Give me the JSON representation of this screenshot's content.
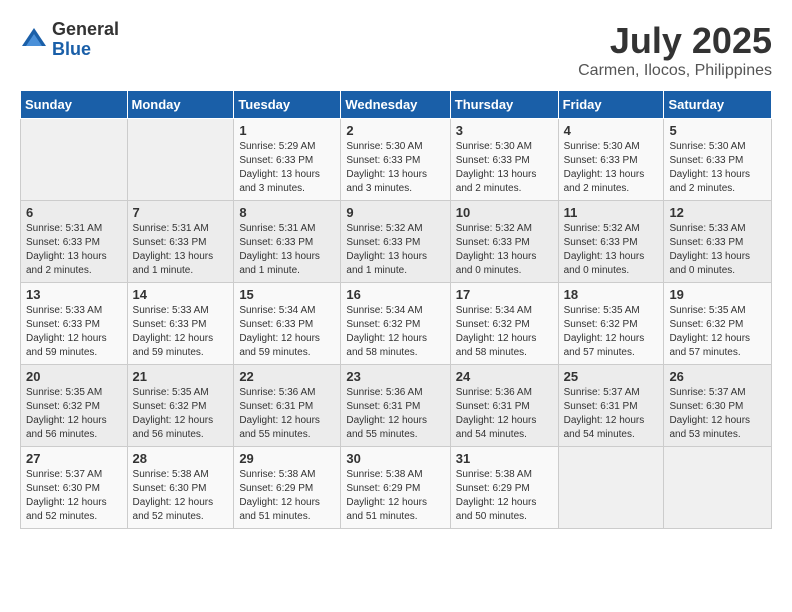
{
  "logo": {
    "general": "General",
    "blue": "Blue"
  },
  "title": {
    "month": "July 2025",
    "location": "Carmen, Ilocos, Philippines"
  },
  "weekdays": [
    "Sunday",
    "Monday",
    "Tuesday",
    "Wednesday",
    "Thursday",
    "Friday",
    "Saturday"
  ],
  "weeks": [
    [
      {
        "day": null
      },
      {
        "day": null
      },
      {
        "day": "1",
        "info": "Sunrise: 5:29 AM\nSunset: 6:33 PM\nDaylight: 13 hours and 3 minutes."
      },
      {
        "day": "2",
        "info": "Sunrise: 5:30 AM\nSunset: 6:33 PM\nDaylight: 13 hours and 3 minutes."
      },
      {
        "day": "3",
        "info": "Sunrise: 5:30 AM\nSunset: 6:33 PM\nDaylight: 13 hours and 2 minutes."
      },
      {
        "day": "4",
        "info": "Sunrise: 5:30 AM\nSunset: 6:33 PM\nDaylight: 13 hours and 2 minutes."
      },
      {
        "day": "5",
        "info": "Sunrise: 5:30 AM\nSunset: 6:33 PM\nDaylight: 13 hours and 2 minutes."
      }
    ],
    [
      {
        "day": "6",
        "info": "Sunrise: 5:31 AM\nSunset: 6:33 PM\nDaylight: 13 hours and 2 minutes."
      },
      {
        "day": "7",
        "info": "Sunrise: 5:31 AM\nSunset: 6:33 PM\nDaylight: 13 hours and 1 minute."
      },
      {
        "day": "8",
        "info": "Sunrise: 5:31 AM\nSunset: 6:33 PM\nDaylight: 13 hours and 1 minute."
      },
      {
        "day": "9",
        "info": "Sunrise: 5:32 AM\nSunset: 6:33 PM\nDaylight: 13 hours and 1 minute."
      },
      {
        "day": "10",
        "info": "Sunrise: 5:32 AM\nSunset: 6:33 PM\nDaylight: 13 hours and 0 minutes."
      },
      {
        "day": "11",
        "info": "Sunrise: 5:32 AM\nSunset: 6:33 PM\nDaylight: 13 hours and 0 minutes."
      },
      {
        "day": "12",
        "info": "Sunrise: 5:33 AM\nSunset: 6:33 PM\nDaylight: 13 hours and 0 minutes."
      }
    ],
    [
      {
        "day": "13",
        "info": "Sunrise: 5:33 AM\nSunset: 6:33 PM\nDaylight: 12 hours and 59 minutes."
      },
      {
        "day": "14",
        "info": "Sunrise: 5:33 AM\nSunset: 6:33 PM\nDaylight: 12 hours and 59 minutes."
      },
      {
        "day": "15",
        "info": "Sunrise: 5:34 AM\nSunset: 6:33 PM\nDaylight: 12 hours and 59 minutes."
      },
      {
        "day": "16",
        "info": "Sunrise: 5:34 AM\nSunset: 6:32 PM\nDaylight: 12 hours and 58 minutes."
      },
      {
        "day": "17",
        "info": "Sunrise: 5:34 AM\nSunset: 6:32 PM\nDaylight: 12 hours and 58 minutes."
      },
      {
        "day": "18",
        "info": "Sunrise: 5:35 AM\nSunset: 6:32 PM\nDaylight: 12 hours and 57 minutes."
      },
      {
        "day": "19",
        "info": "Sunrise: 5:35 AM\nSunset: 6:32 PM\nDaylight: 12 hours and 57 minutes."
      }
    ],
    [
      {
        "day": "20",
        "info": "Sunrise: 5:35 AM\nSunset: 6:32 PM\nDaylight: 12 hours and 56 minutes."
      },
      {
        "day": "21",
        "info": "Sunrise: 5:35 AM\nSunset: 6:32 PM\nDaylight: 12 hours and 56 minutes."
      },
      {
        "day": "22",
        "info": "Sunrise: 5:36 AM\nSunset: 6:31 PM\nDaylight: 12 hours and 55 minutes."
      },
      {
        "day": "23",
        "info": "Sunrise: 5:36 AM\nSunset: 6:31 PM\nDaylight: 12 hours and 55 minutes."
      },
      {
        "day": "24",
        "info": "Sunrise: 5:36 AM\nSunset: 6:31 PM\nDaylight: 12 hours and 54 minutes."
      },
      {
        "day": "25",
        "info": "Sunrise: 5:37 AM\nSunset: 6:31 PM\nDaylight: 12 hours and 54 minutes."
      },
      {
        "day": "26",
        "info": "Sunrise: 5:37 AM\nSunset: 6:30 PM\nDaylight: 12 hours and 53 minutes."
      }
    ],
    [
      {
        "day": "27",
        "info": "Sunrise: 5:37 AM\nSunset: 6:30 PM\nDaylight: 12 hours and 52 minutes."
      },
      {
        "day": "28",
        "info": "Sunrise: 5:38 AM\nSunset: 6:30 PM\nDaylight: 12 hours and 52 minutes."
      },
      {
        "day": "29",
        "info": "Sunrise: 5:38 AM\nSunset: 6:29 PM\nDaylight: 12 hours and 51 minutes."
      },
      {
        "day": "30",
        "info": "Sunrise: 5:38 AM\nSunset: 6:29 PM\nDaylight: 12 hours and 51 minutes."
      },
      {
        "day": "31",
        "info": "Sunrise: 5:38 AM\nSunset: 6:29 PM\nDaylight: 12 hours and 50 minutes."
      },
      {
        "day": null
      },
      {
        "day": null
      }
    ]
  ]
}
